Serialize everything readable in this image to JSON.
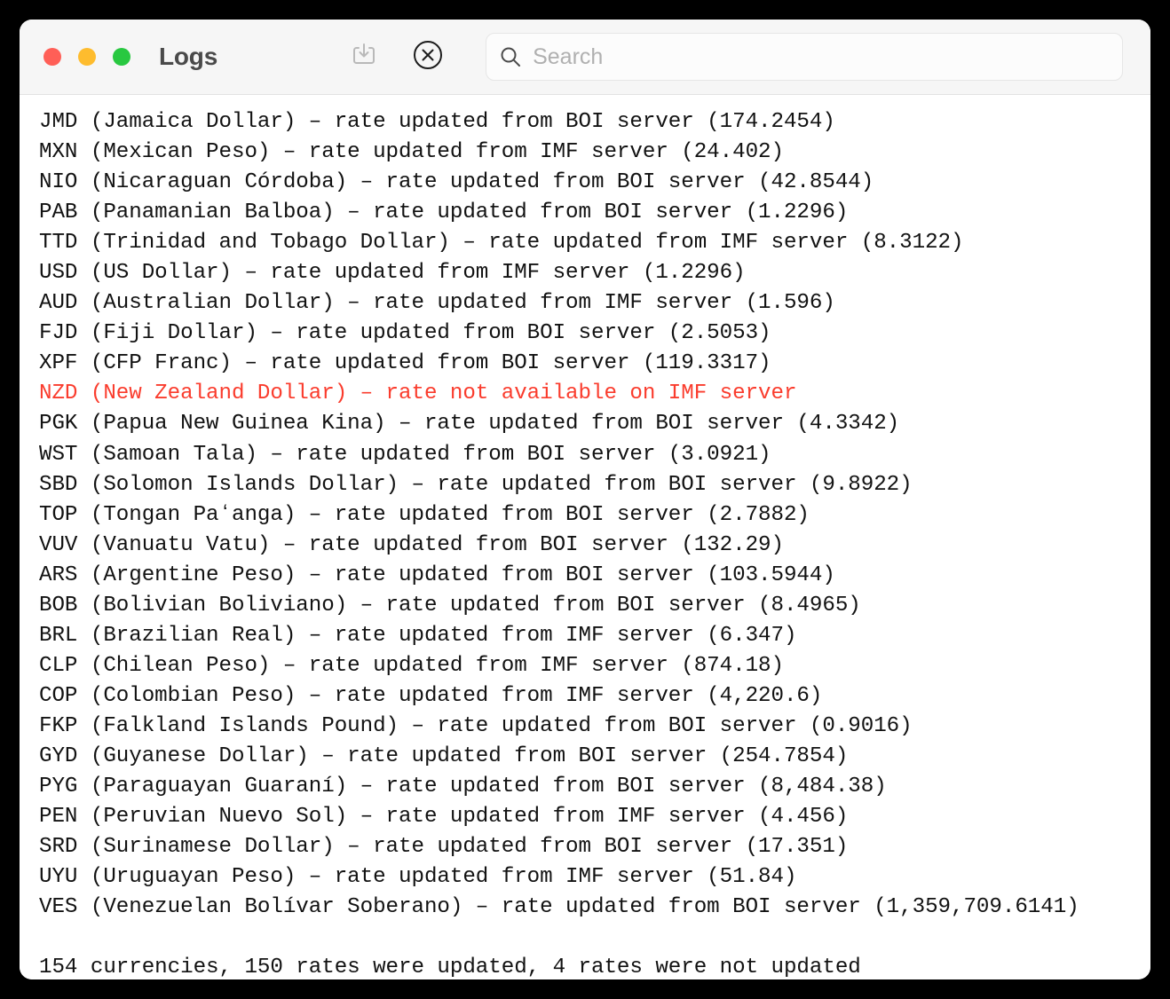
{
  "window": {
    "title": "Logs",
    "traffic_lights": [
      {
        "name": "close",
        "color": "#ff5f57"
      },
      {
        "name": "minimize",
        "color": "#febc2e"
      },
      {
        "name": "zoom",
        "color": "#28c840"
      }
    ]
  },
  "toolbar": {
    "export_icon": "download-tray-icon",
    "clear_icon": "close-circle-icon",
    "search": {
      "icon": "search-icon",
      "placeholder": "Search",
      "value": ""
    }
  },
  "colors": {
    "text": "#121212",
    "error": "#fa3c2d",
    "titlebar_bg": "#f6f6f6",
    "body_bg": "#ffffff"
  },
  "log": {
    "lines": [
      {
        "text": "JMD (Jamaica Dollar) – rate updated from BOI server (174.2454)",
        "level": "info"
      },
      {
        "text": "MXN (Mexican Peso) – rate updated from IMF server (24.402)",
        "level": "info"
      },
      {
        "text": "NIO (Nicaraguan Córdoba) – rate updated from BOI server (42.8544)",
        "level": "info"
      },
      {
        "text": "PAB (Panamanian Balboa) – rate updated from BOI server (1.2296)",
        "level": "info"
      },
      {
        "text": "TTD (Trinidad and Tobago Dollar) – rate updated from IMF server (8.3122)",
        "level": "info"
      },
      {
        "text": "USD (US Dollar) – rate updated from IMF server (1.2296)",
        "level": "info"
      },
      {
        "text": "AUD (Australian Dollar) – rate updated from IMF server (1.596)",
        "level": "info"
      },
      {
        "text": "FJD (Fiji Dollar) – rate updated from BOI server (2.5053)",
        "level": "info"
      },
      {
        "text": "XPF (CFP Franc) – rate updated from BOI server (119.3317)",
        "level": "info"
      },
      {
        "text": "NZD (New Zealand Dollar) – rate not available on IMF server",
        "level": "error"
      },
      {
        "text": "PGK (Papua New Guinea Kina) – rate updated from BOI server (4.3342)",
        "level": "info"
      },
      {
        "text": "WST (Samoan Tala) – rate updated from BOI server (3.0921)",
        "level": "info"
      },
      {
        "text": "SBD (Solomon Islands Dollar) – rate updated from BOI server (9.8922)",
        "level": "info"
      },
      {
        "text": "TOP (Tongan Paʻanga) – rate updated from BOI server (2.7882)",
        "level": "info"
      },
      {
        "text": "VUV (Vanuatu Vatu) – rate updated from BOI server (132.29)",
        "level": "info"
      },
      {
        "text": "ARS (Argentine Peso) – rate updated from BOI server (103.5944)",
        "level": "info"
      },
      {
        "text": "BOB (Bolivian Boliviano) – rate updated from BOI server (8.4965)",
        "level": "info"
      },
      {
        "text": "BRL (Brazilian Real) – rate updated from IMF server (6.347)",
        "level": "info"
      },
      {
        "text": "CLP (Chilean Peso) – rate updated from IMF server (874.18)",
        "level": "info"
      },
      {
        "text": "COP (Colombian Peso) – rate updated from IMF server (4,220.6)",
        "level": "info"
      },
      {
        "text": "FKP (Falkland Islands Pound) – rate updated from BOI server (0.9016)",
        "level": "info"
      },
      {
        "text": "GYD (Guyanese Dollar) – rate updated from BOI server (254.7854)",
        "level": "info"
      },
      {
        "text": "PYG (Paraguayan Guaraní) – rate updated from BOI server (8,484.38)",
        "level": "info"
      },
      {
        "text": "PEN (Peruvian Nuevo Sol) – rate updated from IMF server (4.456)",
        "level": "info"
      },
      {
        "text": "SRD (Surinamese Dollar) – rate updated from BOI server (17.351)",
        "level": "info"
      },
      {
        "text": "UYU (Uruguayan Peso) – rate updated from IMF server (51.84)",
        "level": "info"
      },
      {
        "text": "VES (Venezuelan Bolívar Soberano) – rate updated from BOI server (1,359,709.6141)",
        "level": "info"
      },
      {
        "text": " ",
        "level": "spacer"
      },
      {
        "text": "154 currencies, 150 rates were updated, 4 rates were not updated",
        "level": "summary"
      }
    ]
  }
}
